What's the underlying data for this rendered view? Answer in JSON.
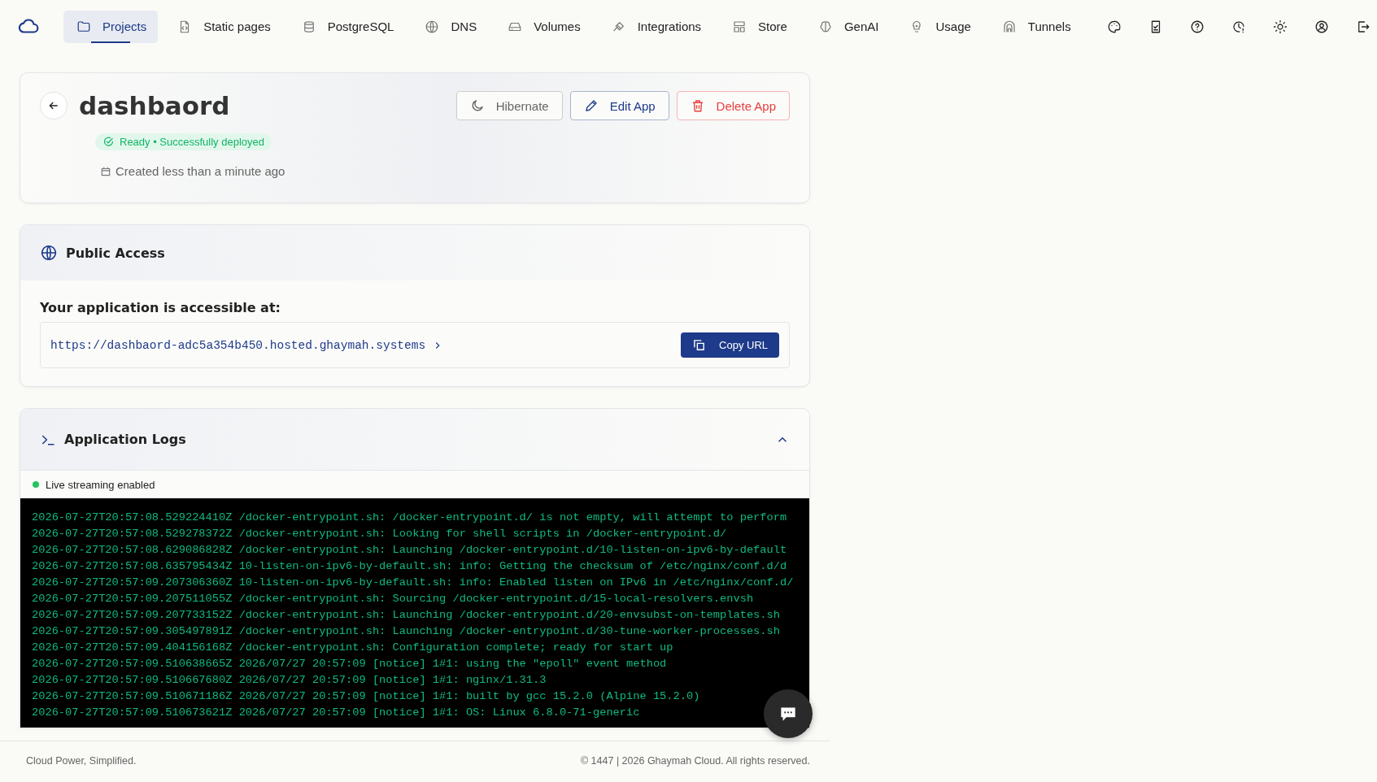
{
  "nav": {
    "items": [
      {
        "label": "Projects",
        "selected": true
      },
      {
        "label": "Static pages",
        "selected": false
      },
      {
        "label": "PostgreSQL",
        "selected": false
      },
      {
        "label": "DNS",
        "selected": false
      },
      {
        "label": "Volumes",
        "selected": false
      },
      {
        "label": "Integrations",
        "selected": false
      },
      {
        "label": "Store",
        "selected": false
      },
      {
        "label": "GenAI",
        "selected": false
      },
      {
        "label": "Usage",
        "selected": false
      },
      {
        "label": "Tunnels",
        "selected": false
      }
    ]
  },
  "app": {
    "name": "dashbaord",
    "status": "Ready • Successfully deployed",
    "created": "Created less than a minute ago",
    "buttons": [
      {
        "label": "Hibernate",
        "kind": "hibernate"
      },
      {
        "label": "Edit App",
        "kind": "edit"
      },
      {
        "label": "Delete App",
        "kind": "delete"
      }
    ]
  },
  "public_access": {
    "title": "Public Access",
    "heading": "Your application is accessible at:",
    "url": "https://dashbaord-adc5a354b450.hosted.ghaymah.systems",
    "copy_button": "Copy URL"
  },
  "logs": {
    "title": "Application Logs",
    "expanded": true,
    "streaming": "Live streaming enabled",
    "lines": [
      "2026-07-27T20:57:08.529224410Z /docker-entrypoint.sh: /docker-entrypoint.d/ is not empty, will attempt to perform",
      "2026-07-27T20:57:08.529278372Z /docker-entrypoint.sh: Looking for shell scripts in /docker-entrypoint.d/",
      "2026-07-27T20:57:08.629086828Z /docker-entrypoint.sh: Launching /docker-entrypoint.d/10-listen-on-ipv6-by-default",
      "2026-07-27T20:57:08.635795434Z 10-listen-on-ipv6-by-default.sh: info: Getting the checksum of /etc/nginx/conf.d/d",
      "2026-07-27T20:57:09.207306360Z 10-listen-on-ipv6-by-default.sh: info: Enabled listen on IPv6 in /etc/nginx/conf.d/",
      "2026-07-27T20:57:09.207511055Z /docker-entrypoint.sh: Sourcing /docker-entrypoint.d/15-local-resolvers.envsh",
      "2026-07-27T20:57:09.207733152Z /docker-entrypoint.sh: Launching /docker-entrypoint.d/20-envsubst-on-templates.sh",
      "2026-07-27T20:57:09.305497891Z /docker-entrypoint.sh: Launching /docker-entrypoint.d/30-tune-worker-processes.sh",
      "2026-07-27T20:57:09.404156168Z /docker-entrypoint.sh: Configuration complete; ready for start up",
      "2026-07-27T20:57:09.510638665Z 2026/07/27 20:57:09 [notice] 1#1: using the \"epoll\" event method",
      "2026-07-27T20:57:09.510667680Z 2026/07/27 20:57:09 [notice] 1#1: nginx/1.31.3",
      "2026-07-27T20:57:09.510671186Z 2026/07/27 20:57:09 [notice] 1#1: built by gcc 15.2.0 (Alpine 15.2.0)",
      "2026-07-27T20:57:09.510673621Z 2026/07/27 20:57:09 [notice] 1#1: OS: Linux 6.8.0-71-generic"
    ]
  },
  "footer": {
    "tagline": "Cloud Power, Simplified.",
    "copyright": "© 1447 | 2026 Ghaymah Cloud. All rights reserved."
  }
}
